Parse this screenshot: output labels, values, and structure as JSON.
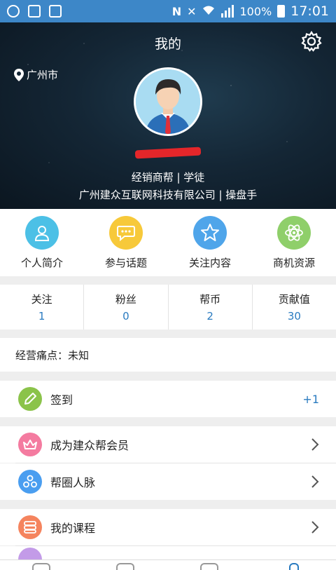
{
  "status_bar": {
    "battery": "100%",
    "time": "17:01",
    "left_icons": [
      "notification-icon",
      "image-icon",
      "screenshot-icon"
    ],
    "right_icons": [
      "nfc-icon",
      "mute-icon",
      "wifi-icon",
      "signal-icon",
      "battery-charging-icon"
    ]
  },
  "header": {
    "title": "我的",
    "location": "广州市",
    "role_line": "经销商帮 | 学徒",
    "company_line": "广州建众互联网科技有限公司 | 操盘手"
  },
  "quick_actions": [
    {
      "label": "个人简介",
      "icon": "person-icon",
      "color": "#4cc0e6"
    },
    {
      "label": "参与话题",
      "icon": "chat-icon",
      "color": "#f7c93a"
    },
    {
      "label": "关注内容",
      "icon": "star-icon",
      "color": "#4fa5ea"
    },
    {
      "label": "商机资源",
      "icon": "atom-icon",
      "color": "#8fcf6a"
    }
  ],
  "stats": [
    {
      "label": "关注",
      "value": "1"
    },
    {
      "label": "粉丝",
      "value": "0"
    },
    {
      "label": "帮币",
      "value": "2"
    },
    {
      "label": "贡献值",
      "value": "30"
    }
  ],
  "pain_point": "经营痛点：未知",
  "menu": {
    "checkin": {
      "label": "签到",
      "value": "+1",
      "icon": "pencil-icon",
      "color": "#8bc34a"
    },
    "member": {
      "label": "成为建众帮会员",
      "icon": "crown-icon",
      "color": "#f47ba0"
    },
    "network": {
      "label": "帮圈人脉",
      "icon": "people-icon",
      "color": "#4a9ef0"
    },
    "courses": {
      "label": "我的课程",
      "icon": "book-icon",
      "color": "#f5845e"
    }
  }
}
